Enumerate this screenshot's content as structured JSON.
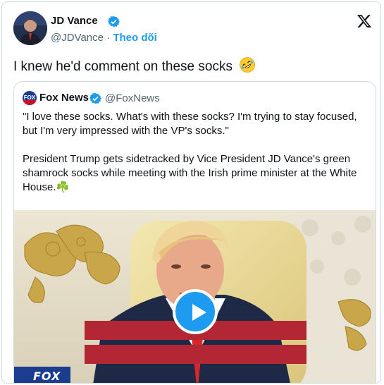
{
  "tweet": {
    "author_name": "JD Vance",
    "author_handle": "@JDVance",
    "separator": " · ",
    "follow_label": "Theo dõi",
    "text": "I knew he'd comment on these socks",
    "emoji": "rolling-on-floor-laughing-emoji"
  },
  "quote": {
    "author_name": "Fox News",
    "author_handle": "@FoxNews",
    "paragraph1": "\"I love these socks. What's with these socks? I'm trying to stay focused, but I'm very impressed with the VP's socks.\"",
    "paragraph2": "President Trump gets sidetracked by Vice President JD Vance's green shamrock socks while meeting with the Irish prime minister at the White House.☘️",
    "media": {
      "type": "video",
      "overlay_text": "FOX"
    }
  },
  "colors": {
    "accent": "#1d9bf0",
    "text": "#0f1419",
    "secondary": "#536471",
    "border": "#cfd9de"
  }
}
